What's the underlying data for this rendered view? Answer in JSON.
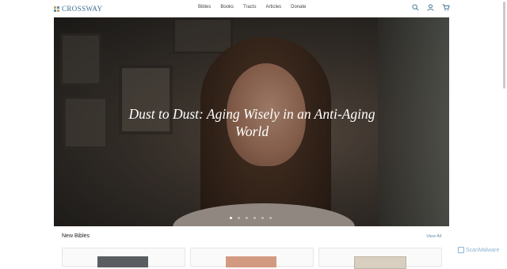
{
  "header": {
    "logo_text": "CROSSWAY",
    "nav": [
      "Bibles",
      "Books",
      "Tracts",
      "Articles",
      "Donate"
    ],
    "icons": [
      "search-icon",
      "account-icon",
      "cart-icon"
    ],
    "accent_color": "#3a6f8f"
  },
  "hero": {
    "title": "Dust to Dust: Aging Wisely in an Anti-Aging World",
    "slide_count": 6,
    "active_slide": 1
  },
  "section": {
    "title": "New Bibles",
    "view_all": "View All"
  },
  "watermark": "ScanMalware"
}
